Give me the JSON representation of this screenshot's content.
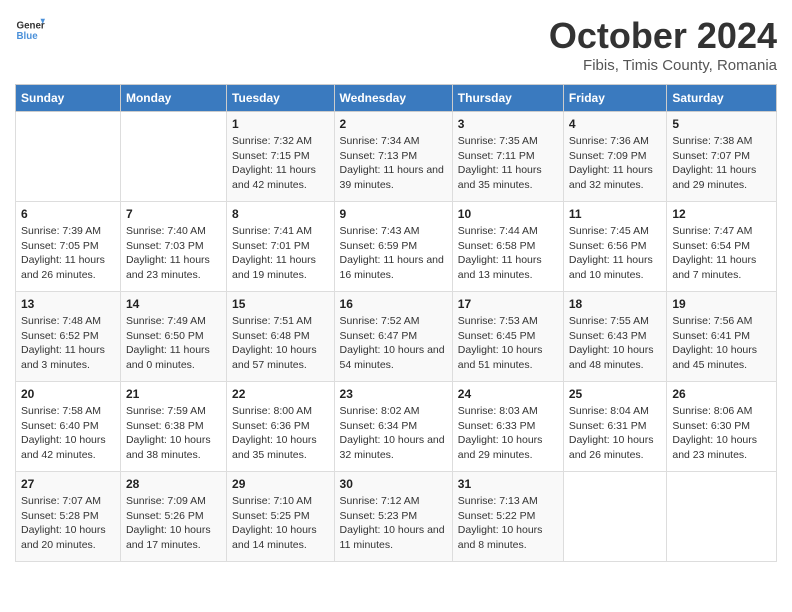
{
  "header": {
    "logo_general": "General",
    "logo_blue": "Blue",
    "month": "October 2024",
    "location": "Fibis, Timis County, Romania"
  },
  "columns": [
    "Sunday",
    "Monday",
    "Tuesday",
    "Wednesday",
    "Thursday",
    "Friday",
    "Saturday"
  ],
  "weeks": [
    [
      {
        "day": "",
        "info": ""
      },
      {
        "day": "",
        "info": ""
      },
      {
        "day": "1",
        "info": "Sunrise: 7:32 AM\nSunset: 7:15 PM\nDaylight: 11 hours and 42 minutes."
      },
      {
        "day": "2",
        "info": "Sunrise: 7:34 AM\nSunset: 7:13 PM\nDaylight: 11 hours and 39 minutes."
      },
      {
        "day": "3",
        "info": "Sunrise: 7:35 AM\nSunset: 7:11 PM\nDaylight: 11 hours and 35 minutes."
      },
      {
        "day": "4",
        "info": "Sunrise: 7:36 AM\nSunset: 7:09 PM\nDaylight: 11 hours and 32 minutes."
      },
      {
        "day": "5",
        "info": "Sunrise: 7:38 AM\nSunset: 7:07 PM\nDaylight: 11 hours and 29 minutes."
      }
    ],
    [
      {
        "day": "6",
        "info": "Sunrise: 7:39 AM\nSunset: 7:05 PM\nDaylight: 11 hours and 26 minutes."
      },
      {
        "day": "7",
        "info": "Sunrise: 7:40 AM\nSunset: 7:03 PM\nDaylight: 11 hours and 23 minutes."
      },
      {
        "day": "8",
        "info": "Sunrise: 7:41 AM\nSunset: 7:01 PM\nDaylight: 11 hours and 19 minutes."
      },
      {
        "day": "9",
        "info": "Sunrise: 7:43 AM\nSunset: 6:59 PM\nDaylight: 11 hours and 16 minutes."
      },
      {
        "day": "10",
        "info": "Sunrise: 7:44 AM\nSunset: 6:58 PM\nDaylight: 11 hours and 13 minutes."
      },
      {
        "day": "11",
        "info": "Sunrise: 7:45 AM\nSunset: 6:56 PM\nDaylight: 11 hours and 10 minutes."
      },
      {
        "day": "12",
        "info": "Sunrise: 7:47 AM\nSunset: 6:54 PM\nDaylight: 11 hours and 7 minutes."
      }
    ],
    [
      {
        "day": "13",
        "info": "Sunrise: 7:48 AM\nSunset: 6:52 PM\nDaylight: 11 hours and 3 minutes."
      },
      {
        "day": "14",
        "info": "Sunrise: 7:49 AM\nSunset: 6:50 PM\nDaylight: 11 hours and 0 minutes."
      },
      {
        "day": "15",
        "info": "Sunrise: 7:51 AM\nSunset: 6:48 PM\nDaylight: 10 hours and 57 minutes."
      },
      {
        "day": "16",
        "info": "Sunrise: 7:52 AM\nSunset: 6:47 PM\nDaylight: 10 hours and 54 minutes."
      },
      {
        "day": "17",
        "info": "Sunrise: 7:53 AM\nSunset: 6:45 PM\nDaylight: 10 hours and 51 minutes."
      },
      {
        "day": "18",
        "info": "Sunrise: 7:55 AM\nSunset: 6:43 PM\nDaylight: 10 hours and 48 minutes."
      },
      {
        "day": "19",
        "info": "Sunrise: 7:56 AM\nSunset: 6:41 PM\nDaylight: 10 hours and 45 minutes."
      }
    ],
    [
      {
        "day": "20",
        "info": "Sunrise: 7:58 AM\nSunset: 6:40 PM\nDaylight: 10 hours and 42 minutes."
      },
      {
        "day": "21",
        "info": "Sunrise: 7:59 AM\nSunset: 6:38 PM\nDaylight: 10 hours and 38 minutes."
      },
      {
        "day": "22",
        "info": "Sunrise: 8:00 AM\nSunset: 6:36 PM\nDaylight: 10 hours and 35 minutes."
      },
      {
        "day": "23",
        "info": "Sunrise: 8:02 AM\nSunset: 6:34 PM\nDaylight: 10 hours and 32 minutes."
      },
      {
        "day": "24",
        "info": "Sunrise: 8:03 AM\nSunset: 6:33 PM\nDaylight: 10 hours and 29 minutes."
      },
      {
        "day": "25",
        "info": "Sunrise: 8:04 AM\nSunset: 6:31 PM\nDaylight: 10 hours and 26 minutes."
      },
      {
        "day": "26",
        "info": "Sunrise: 8:06 AM\nSunset: 6:30 PM\nDaylight: 10 hours and 23 minutes."
      }
    ],
    [
      {
        "day": "27",
        "info": "Sunrise: 7:07 AM\nSunset: 5:28 PM\nDaylight: 10 hours and 20 minutes."
      },
      {
        "day": "28",
        "info": "Sunrise: 7:09 AM\nSunset: 5:26 PM\nDaylight: 10 hours and 17 minutes."
      },
      {
        "day": "29",
        "info": "Sunrise: 7:10 AM\nSunset: 5:25 PM\nDaylight: 10 hours and 14 minutes."
      },
      {
        "day": "30",
        "info": "Sunrise: 7:12 AM\nSunset: 5:23 PM\nDaylight: 10 hours and 11 minutes."
      },
      {
        "day": "31",
        "info": "Sunrise: 7:13 AM\nSunset: 5:22 PM\nDaylight: 10 hours and 8 minutes."
      },
      {
        "day": "",
        "info": ""
      },
      {
        "day": "",
        "info": ""
      }
    ]
  ]
}
